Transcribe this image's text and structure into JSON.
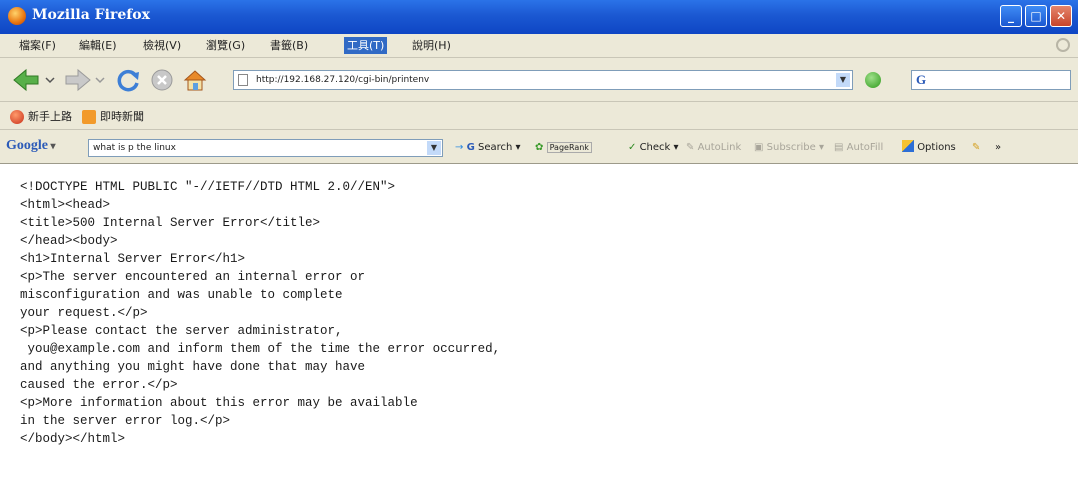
{
  "window": {
    "title": "Mozilla Firefox",
    "controls": [
      "minimize-icon",
      "maximize-icon",
      "close-icon"
    ]
  },
  "menubar": {
    "items": [
      {
        "label": "檔案(F)"
      },
      {
        "label": "編輯(E)"
      },
      {
        "label": "檢視(V)"
      },
      {
        "label": "瀏覽(G)"
      },
      {
        "label": "書籤(B)"
      },
      {
        "label": "工具(T)",
        "active": true
      },
      {
        "label": "說明(H)"
      }
    ]
  },
  "navigation": {
    "url": "http://192.168.27.120/cgi-bin/printenv",
    "search_value": "",
    "icons": [
      "back-icon",
      "forward-icon",
      "reload-icon",
      "stop-icon",
      "home-icon",
      "go-icon"
    ]
  },
  "bookmarks": {
    "items": [
      {
        "label": "新手上路",
        "icon": "firefox-icon"
      },
      {
        "label": "即時新聞",
        "icon": "rss-icon"
      }
    ]
  },
  "google_toolbar": {
    "logo": "Google",
    "search_value": "what is p the linux",
    "items": [
      {
        "label": "Search",
        "enabled": true
      },
      {
        "label": "PageRank",
        "enabled": true
      },
      {
        "label": "Check",
        "enabled": true
      },
      {
        "label": "AutoLink",
        "enabled": false
      },
      {
        "label": "Subscribe",
        "enabled": false
      },
      {
        "label": "AutoFill",
        "enabled": false
      },
      {
        "label": "Options",
        "enabled": true
      },
      {
        "label": "»",
        "enabled": true
      }
    ]
  },
  "page": {
    "source": "<!DOCTYPE HTML PUBLIC \"-//IETF//DTD HTML 2.0//EN\">\n<html><head>\n<title>500 Internal Server Error</title>\n</head><body>\n<h1>Internal Server Error</h1>\n<p>The server encountered an internal error or\nmisconfiguration and was unable to complete\nyour request.</p>\n<p>Please contact the server administrator,\n you@example.com and inform them of the time the error occurred,\nand anything you might have done that may have\ncaused the error.</p>\n<p>More information about this error may be available\nin the server error log.</p>\n</body></html>"
  }
}
